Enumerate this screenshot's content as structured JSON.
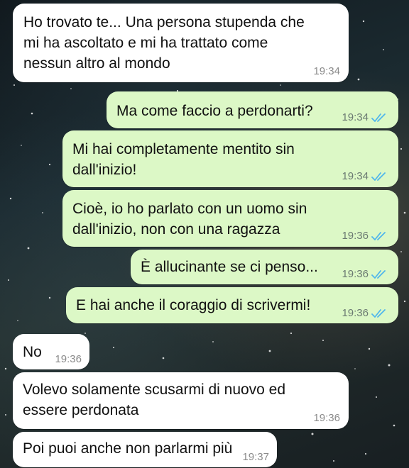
{
  "colors": {
    "incoming_bubble": "#ffffff",
    "outgoing_bubble": "#dcf8c6",
    "read_ticks": "#4fb6ec"
  },
  "icons": {
    "read_receipt": "double-check-icon"
  },
  "messages": [
    {
      "direction": "incoming",
      "text": "Ho trovato te... Una persona stupenda che\nmi ha ascoltato e mi ha trattato come\nnessun altro al mondo",
      "time": "19:34"
    },
    {
      "direction": "outgoing",
      "text": "Ma come faccio a perdonarti?",
      "time": "19:34",
      "status": "read"
    },
    {
      "direction": "outgoing",
      "text": "Mi hai completamente mentito sin\ndall'inizio!",
      "time": "19:34",
      "status": "read"
    },
    {
      "direction": "outgoing",
      "text": "Cioè, io ho parlato con un uomo sin\ndall'inizio, non con una ragazza",
      "time": "19:36",
      "status": "read"
    },
    {
      "direction": "outgoing",
      "text": "È allucinante se ci penso...",
      "time": "19:36",
      "status": "read"
    },
    {
      "direction": "outgoing",
      "text": "E hai anche il coraggio di scrivermi!",
      "time": "19:36",
      "status": "read"
    },
    {
      "direction": "incoming",
      "text": "No",
      "time": "19:36"
    },
    {
      "direction": "incoming",
      "text": "Volevo solamente scusarmi di nuovo ed\nessere perdonata",
      "time": "19:36"
    },
    {
      "direction": "incoming",
      "text": "Poi puoi anche non parlarmi più",
      "time": "19:37"
    }
  ]
}
